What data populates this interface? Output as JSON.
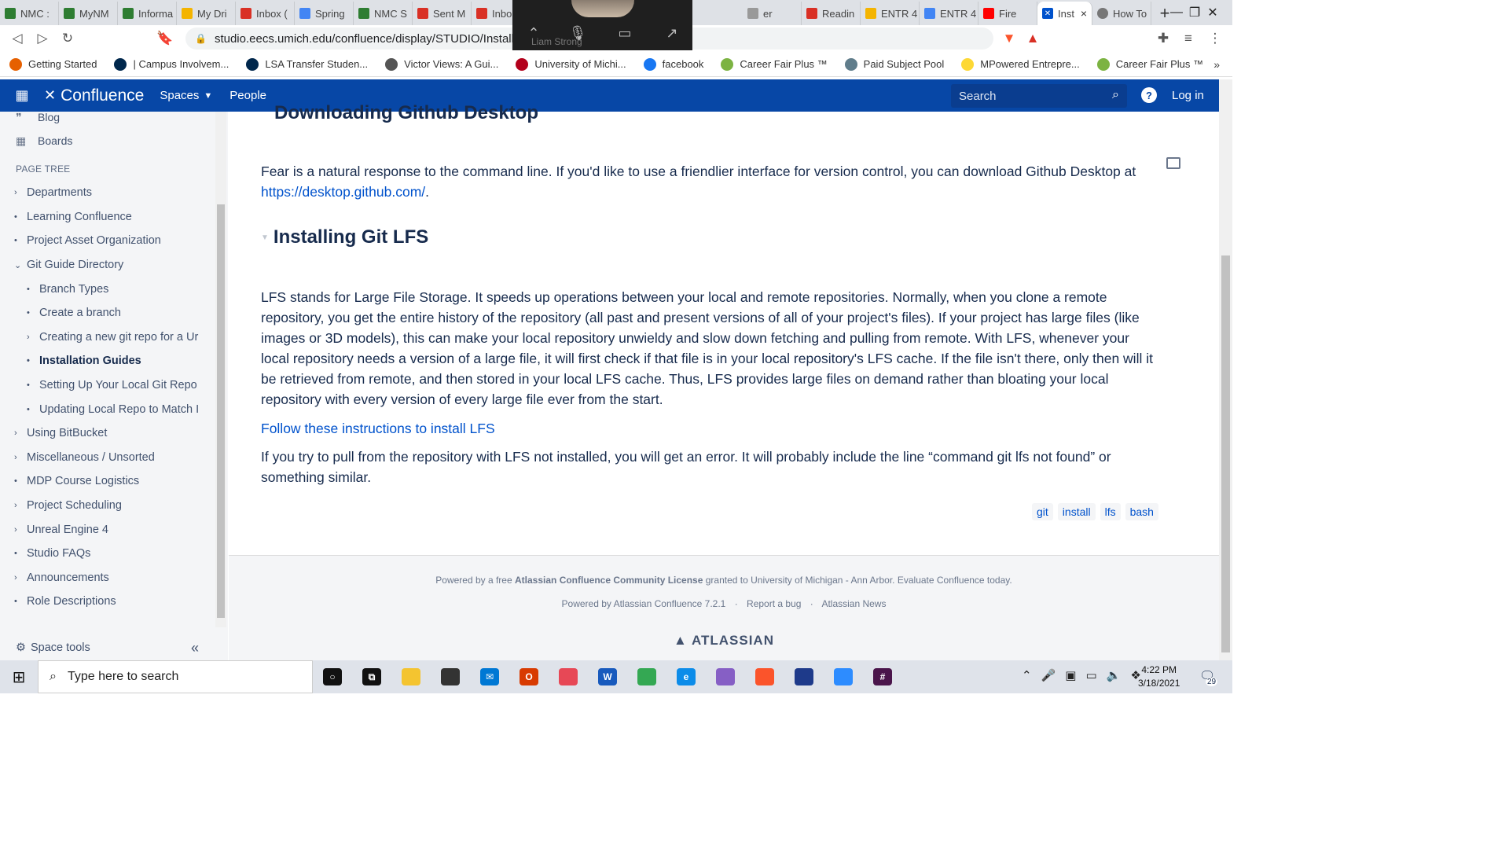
{
  "browser": {
    "tabs": [
      {
        "title": "NMC : ",
        "icon": "green-dot-icon",
        "color": "#2e7d32"
      },
      {
        "title": "MyNM",
        "icon": "green-dot-icon",
        "color": "#2e7d32"
      },
      {
        "title": "Informa",
        "icon": "green-dot-icon",
        "color": "#2e7d32"
      },
      {
        "title": "My Dri",
        "icon": "drive-icon",
        "color": "#f4b400"
      },
      {
        "title": "Inbox (",
        "icon": "gmail-icon",
        "color": "#d93025"
      },
      {
        "title": "Spring",
        "icon": "docs-icon",
        "color": "#4285f4"
      },
      {
        "title": "NMC S",
        "icon": "green-dot-icon",
        "color": "#2e7d32"
      },
      {
        "title": "Sent M",
        "icon": "gmail-icon",
        "color": "#d93025"
      },
      {
        "title": "Inbo",
        "icon": "gmail-icon",
        "color": "#d93025"
      }
    ],
    "tabs_right": [
      {
        "title": "er",
        "icon": "blank-icon",
        "color": "#999999"
      },
      {
        "title": "Readin",
        "icon": "reading-icon",
        "color": "#d93025"
      },
      {
        "title": "ENTR 4",
        "icon": "drive-icon",
        "color": "#f4b400"
      },
      {
        "title": "ENTR 4",
        "icon": "docs-icon",
        "color": "#4285f4"
      },
      {
        "title": "Fire",
        "icon": "youtube-icon",
        "color": "#ff0000"
      }
    ],
    "active_tab": {
      "title": "Inst"
    },
    "last_tab": {
      "title": "How To"
    },
    "url": "studio.eecs.umich.edu/confluence/display/STUDIO/Installatio"
  },
  "zoom_overlay": {
    "participant": "Liam Strong"
  },
  "bookmarks": [
    {
      "label": "Getting Started",
      "color": "#e66000"
    },
    {
      "label": "| Campus Involvem...",
      "color": "#00274c"
    },
    {
      "label": "LSA Transfer Studen...",
      "color": "#00274c"
    },
    {
      "label": "Victor Views: A Gui...",
      "color": "#555555"
    },
    {
      "label": "University of Michi...",
      "color": "#b3001b"
    },
    {
      "label": "facebook",
      "color": "#1877f2"
    },
    {
      "label": "Career Fair Plus ™",
      "color": "#7cb342"
    },
    {
      "label": "Paid Subject Pool",
      "color": "#607d8b"
    },
    {
      "label": "MPowered Entrepre...",
      "color": "#fdd835"
    },
    {
      "label": "Career Fair Plus ™",
      "color": "#7cb342"
    }
  ],
  "confluence": {
    "product": "Confluence",
    "nav": {
      "spaces": "Spaces",
      "people": "People"
    },
    "search_placeholder": "Search",
    "login": "Log in"
  },
  "sidebar": {
    "top_items": [
      {
        "label": "Blog",
        "icon": "quote-icon"
      },
      {
        "label": "Boards",
        "icon": "board-icon"
      }
    ],
    "page_tree_title": "PAGE TREE",
    "tree": [
      {
        "label": "Departments",
        "toggle": "›",
        "child": false,
        "active": false
      },
      {
        "label": "Learning Confluence",
        "toggle": "•",
        "child": false,
        "active": false
      },
      {
        "label": "Project Asset Organization",
        "toggle": "•",
        "child": false,
        "active": false
      },
      {
        "label": "Git Guide Directory",
        "toggle": "⌄",
        "child": false,
        "active": false
      },
      {
        "label": "Branch Types",
        "toggle": "•",
        "child": true,
        "active": false
      },
      {
        "label": "Create a branch",
        "toggle": "•",
        "child": true,
        "active": false
      },
      {
        "label": "Creating a new git repo for a Ur",
        "toggle": "›",
        "child": true,
        "active": false
      },
      {
        "label": "Installation Guides",
        "toggle": "•",
        "child": true,
        "active": true
      },
      {
        "label": "Setting Up Your Local Git Repo",
        "toggle": "•",
        "child": true,
        "active": false
      },
      {
        "label": "Updating Local Repo to Match I",
        "toggle": "•",
        "child": true,
        "active": false
      },
      {
        "label": "Using BitBucket",
        "toggle": "›",
        "child": false,
        "active": false
      },
      {
        "label": "Miscellaneous / Unsorted",
        "toggle": "›",
        "child": false,
        "active": false
      },
      {
        "label": "MDP Course Logistics",
        "toggle": "•",
        "child": false,
        "active": false
      },
      {
        "label": "Project Scheduling",
        "toggle": "›",
        "child": false,
        "active": false
      },
      {
        "label": "Unreal Engine 4",
        "toggle": "›",
        "child": false,
        "active": false
      },
      {
        "label": "Studio FAQs",
        "toggle": "•",
        "child": false,
        "active": false
      },
      {
        "label": "Announcements",
        "toggle": "›",
        "child": false,
        "active": false
      },
      {
        "label": "Role Descriptions",
        "toggle": "•",
        "child": false,
        "active": false
      }
    ],
    "space_tools": "Space tools"
  },
  "content": {
    "heading_partial": "Downloading Github Desktop",
    "desktop_para_text": "Fear is a natural response to the command line. If you'd like to use a friendlier interface for version control, you can download Github Desktop at ",
    "desktop_link": "https://desktop.github.com/",
    "desktop_para_end": ".",
    "lfs_heading": "Installing Git LFS",
    "lfs_para": "LFS stands for Large File Storage. It speeds up operations between your local and remote repositories. Normally, when you clone a remote repository, you get the entire history of the repository (all past and present versions of all of your project's files). If your project has large files (like images or 3D models), this can make your local repository unwieldy and slow down fetching and pulling from remote. With LFS, whenever your local repository needs a version of a large file, it will first check if that file is in your local repository's LFS cache. If the file isn't there, only then will it be retrieved from remote, and then stored in your local LFS cache. Thus, LFS provides large files on demand rather than bloating your local repository with every version of every large file ever from the start.",
    "lfs_link": "Follow these instructions to install LFS",
    "error_para": "If you try to pull from the repository with LFS not installed, you will get an error. It will probably include the line “command git lfs not found” or something similar.",
    "labels": [
      "git",
      "install",
      "lfs",
      "bash"
    ]
  },
  "footer": {
    "line1_a": "Powered by a free ",
    "line1_b": "Atlassian Confluence Community License",
    "line1_c": " granted to University of Michigan - Ann Arbor. Evaluate Confluence today.",
    "powered": "Powered by Atlassian Confluence 7.2.1",
    "report": "Report a bug",
    "news": "Atlassian News",
    "brand": "ATLASSIAN"
  },
  "taskbar": {
    "search_placeholder": "Type here to search",
    "time": "4:22 PM",
    "date": "3/18/2021",
    "notifications": "29",
    "apps": [
      {
        "name": "cortana-icon",
        "glyph": "○",
        "color": "#111111"
      },
      {
        "name": "task-view-icon",
        "glyph": "⧉",
        "color": "#111111"
      },
      {
        "name": "file-explorer-icon",
        "glyph": "",
        "color": "#f4c430"
      },
      {
        "name": "store-icon",
        "glyph": "",
        "color": "#333333"
      },
      {
        "name": "mail-icon",
        "glyph": "✉",
        "color": "#0078d4"
      },
      {
        "name": "office-icon",
        "glyph": "O",
        "color": "#d83b01"
      },
      {
        "name": "snip-icon",
        "glyph": "",
        "color": "#e74856"
      },
      {
        "name": "word-icon",
        "glyph": "W",
        "color": "#185abd"
      },
      {
        "name": "chrome-icon",
        "glyph": "",
        "color": "#34a853"
      },
      {
        "name": "edge-icon",
        "glyph": "e",
        "color": "#0c8ce9"
      },
      {
        "name": "visual-studio-icon",
        "glyph": "",
        "color": "#865fc5"
      },
      {
        "name": "brave-icon",
        "glyph": "",
        "color": "#fb542b"
      },
      {
        "name": "app-icon",
        "glyph": "",
        "color": "#1e3a8a"
      },
      {
        "name": "zoom-icon",
        "glyph": "",
        "color": "#2d8cff"
      },
      {
        "name": "slack-icon",
        "glyph": "#",
        "color": "#4a154b"
      }
    ]
  }
}
